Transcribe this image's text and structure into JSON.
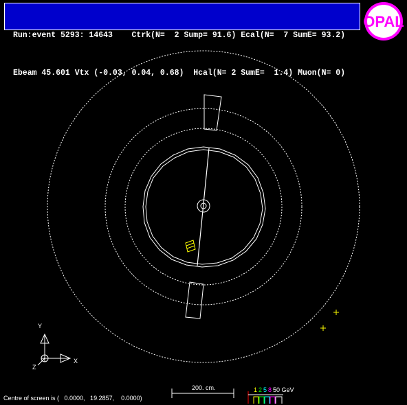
{
  "header": {
    "line1": "Run:event 5293: 14643    Ctrk(N=  2 Sump= 91.6) Ecal(N=  7 SumE= 93.2)",
    "line2": "Ebeam 45.601 Vtx (-0.03, 0.04, 0.68)  Hcal(N= 2 SumE=  1.4) Muon(N= 0)"
  },
  "logo": {
    "text": "OPAL",
    "color": "#ff00ff"
  },
  "axes": {
    "y_label": "Y",
    "x_label": "X",
    "z_label": "Z"
  },
  "scale": {
    "label": "200. cm."
  },
  "energy_scale": {
    "digits": [
      {
        "text": "1",
        "color": "#ffff00"
      },
      {
        "text": "2",
        "color": "#00ff00"
      },
      {
        "text": "5",
        "color": "#00ffff"
      },
      {
        "text": "8",
        "color": "#ff00ff"
      },
      {
        "text": "50 GeV",
        "color": "#ffffff"
      }
    ]
  },
  "footer": {
    "centre": "Centre of screen is (   0.0000,   19.2857,    0.0000)"
  },
  "colors": {
    "detector": "#ffffff",
    "hits": "#ffff00",
    "header_bg": "#0000cc"
  }
}
